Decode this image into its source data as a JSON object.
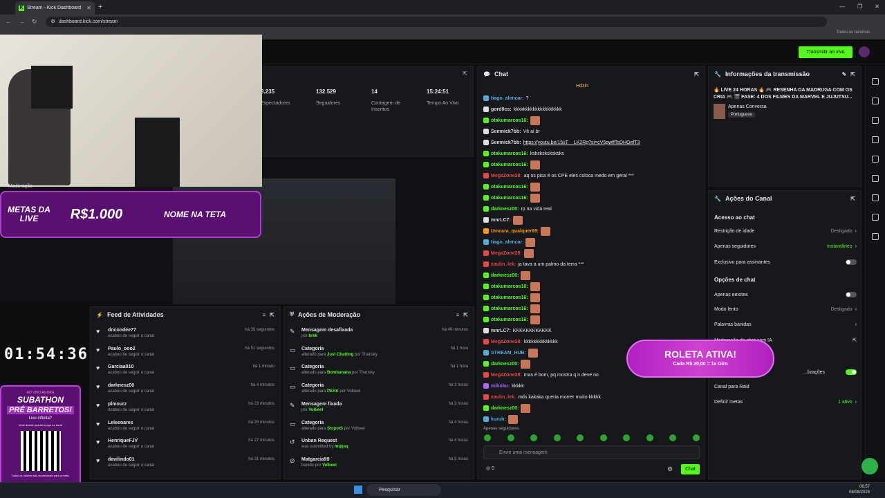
{
  "browser": {
    "tab_title": "Stream - Kick Dashboard",
    "url": "dashboard.kick.com/stream",
    "bookmarks": "Todos os favoritos"
  },
  "header": {
    "go_live": "Transmitir ao vivo"
  },
  "stats": [
    {
      "value": "3.235",
      "label": "Espectadores"
    },
    {
      "value": "132.529",
      "label": "Seguidores"
    },
    {
      "value": "14",
      "label": "Contagem de Inscritos"
    },
    {
      "value": "15:24:51",
      "label": "Tempo Ao Vivo"
    }
  ],
  "webcam_overlay": {
    "mod_label": "Moderação",
    "goal_left": "METAS DA LIVE",
    "goal_value": "R$1.000",
    "goal_right": "NOME NA TETA"
  },
  "timer": "01:54:36",
  "subathon": {
    "t1": "AO VIVO AGORA",
    "t2": "SUBATHON",
    "t3": "PRÉ BARRETOS!",
    "t4": "Live infinita?",
    "t5": "Você decide quanto tempo eu dura!",
    "t6": "Todos os valores são acumulados para a meta."
  },
  "feed": {
    "title": "Feed de Atividades",
    "items": [
      {
        "name": "dncondee77",
        "sub": "acabou de seguir o canal",
        "time": "há 35 segundos"
      },
      {
        "name": "Paulo_ooo2",
        "sub": "acabou de seguir o canal",
        "time": "há 51 segundos"
      },
      {
        "name": "Garciaa010",
        "sub": "acabou de seguir o canal",
        "time": "há 1 minuto"
      },
      {
        "name": "darknesz00",
        "sub": "acabou de seguir o canal",
        "time": "há 4 minutos"
      },
      {
        "name": "plmourz",
        "sub": "acabou de seguir o canal",
        "time": "há 23 minutos"
      },
      {
        "name": "Lelesoares",
        "sub": "acabou de seguir o canal",
        "time": "há 26 minutos"
      },
      {
        "name": "HenriqueFJV",
        "sub": "acabou de seguir o canal",
        "time": "há 27 minutos"
      },
      {
        "name": "davilindo01",
        "sub": "acabou de seguir o canal",
        "time": "há 31 minutos"
      }
    ]
  },
  "mod": {
    "title": "Ações de Moderação",
    "items": [
      {
        "name": "Mensagem desafixada",
        "pre": "por",
        "hl": "brkk",
        "post": "",
        "time": "há 49 minutos"
      },
      {
        "name": "Categoria",
        "pre": "alterado para",
        "hl": "Just Chatting",
        "post": "por Tharisky",
        "time": "há 1 hora"
      },
      {
        "name": "Categoria",
        "pre": "alterado para",
        "hl": "Bombanana",
        "post": "por Tharisky",
        "time": "há 1 hora"
      },
      {
        "name": "Categoria",
        "pre": "alterado para",
        "hl": "PEAK",
        "post": "por Volbeel",
        "time": "há 3 horas"
      },
      {
        "name": "Mensagem fixada",
        "pre": "por",
        "hl": "Volbeel",
        "post": "",
        "time": "há 3 horas"
      },
      {
        "name": "Categoria",
        "pre": "alterado para",
        "hl": "StopotS",
        "post": "por Volbeel",
        "time": "há 4 horas"
      },
      {
        "name": "Unban Request",
        "pre": "was submitted by",
        "hl": "mqqsq",
        "post": "",
        "time": "há 4 horas"
      },
      {
        "name": "Matgarcia99",
        "pre": "banido por",
        "hl": "Volbeel",
        "post": "",
        "time": "há 5 horas"
      }
    ]
  },
  "chat": {
    "title": "Chat",
    "pinned": "Hdzin",
    "placeholder": "Envie uma mensagem",
    "send": "Chat",
    "points": "0",
    "followers_only": "Apenas seguidores",
    "lines": [
      {
        "u": "tiago_alencar",
        "c": "#5ad",
        "m": "?"
      },
      {
        "u": "gord0cs",
        "c": "#ddd",
        "m": "kkkkkkkkkkkkkkkkkkkk"
      },
      {
        "u": "otakumarcos16",
        "c": "#53fc18",
        "m": ""
      },
      {
        "u": "Semnick7bb",
        "c": "#ddd",
        "m": "Vê ai br"
      },
      {
        "u": "Semnick7bb",
        "c": "#ddd",
        "m": "https://youtu.be/15sT__LK2Rg?si=cV5pwffTsDHOefT3"
      },
      {
        "u": "otakumarcos16",
        "c": "#53fc18",
        "m": "ksksksksksksks"
      },
      {
        "u": "otakumarcos16",
        "c": "#53fc18",
        "m": ""
      },
      {
        "u": "MegaZone28",
        "c": "#e44",
        "m": "aq os pica é os CPE eles coloca medo em geral ***"
      },
      {
        "u": "otakumarcos16",
        "c": "#53fc18",
        "m": ""
      },
      {
        "u": "otakumarcos16",
        "c": "#53fc18",
        "m": ""
      },
      {
        "u": "darknesz00",
        "c": "#53fc18",
        "m": "rp na vida real"
      },
      {
        "u": "mnrLC7",
        "c": "#ddd",
        "m": ""
      },
      {
        "u": "Umcara_qualquer69",
        "c": "#f90",
        "m": ""
      },
      {
        "u": "tiago_alencar",
        "c": "#5ad",
        "m": ""
      },
      {
        "u": "MegaZone28",
        "c": "#e44",
        "m": ""
      },
      {
        "u": "xaulin_lek",
        "c": "#e44",
        "m": "ja tava a um palmo da terra ***"
      },
      {
        "u": "darknesz00",
        "c": "#53fc18",
        "m": ""
      },
      {
        "u": "otakumarcos16",
        "c": "#53fc18",
        "m": ""
      },
      {
        "u": "otakumarcos16",
        "c": "#53fc18",
        "m": ""
      },
      {
        "u": "otakumarcos16",
        "c": "#53fc18",
        "m": ""
      },
      {
        "u": "otakumarcos16",
        "c": "#53fc18",
        "m": ""
      },
      {
        "u": "mnrLC7",
        "c": "#ddd",
        "m": "KKKKKKKKKKKK"
      },
      {
        "u": "MegaZone28",
        "c": "#e44",
        "m": "kkkkkkkkkkkkkk"
      },
      {
        "u": "STREAM_HUB",
        "c": "#5ad",
        "m": ""
      },
      {
        "u": "darknesz00",
        "c": "#53fc18",
        "m": ""
      },
      {
        "u": "MegaZone28",
        "c": "#e44",
        "m": "mas é bom, pq mostra q n deve no"
      },
      {
        "u": "mihoku",
        "c": "#a6f",
        "m": "kkkkk"
      },
      {
        "u": "xaulin_lek",
        "c": "#e44",
        "m": "mds kakaka queria morrer muito kkkkk"
      },
      {
        "u": "darknesz00",
        "c": "#53fc18",
        "m": ""
      },
      {
        "u": "kuruh",
        "c": "#5ad",
        "m": ""
      }
    ]
  },
  "info": {
    "title": "Informações da transmissão",
    "stream_title": "🔥 LIVE 24 HORAS 🔥 🎮 RESENHA DA MADRUGA COM OS CRIA 🎮 🎬 FASE: 4 DOS FILMES DA MARVEL E JUJUTSU...",
    "category": "Apenas Conversa",
    "language": "Portuguese"
  },
  "actions": {
    "title": "Ações do Canal",
    "sec1": "Acesso ao chat",
    "age": "Restrição de idade",
    "age_v": "Desligado",
    "followers": "Apenas seguidores",
    "followers_v": "Instantâneo",
    "subs": "Exclusivo para assinantes",
    "sec2": "Opções de chat",
    "emotes": "Apenas emotes",
    "slow": "Modo lento",
    "slow_v": "Desligado",
    "banned": "Palavras banidas",
    "mod_ia": "Moderação de chat com IA",
    "upd": "...lizações",
    "raid": "Canal para Raid",
    "goals": "Definir metas",
    "goals_v": "1 ativo"
  },
  "roleta": {
    "title": "ROLETA ATIVA!",
    "sub": "Cada R$ 20,00 = 1x Giro"
  },
  "taskbar": {
    "search": "Pesquisar",
    "time": "06:57",
    "date": "08/08/2026"
  }
}
